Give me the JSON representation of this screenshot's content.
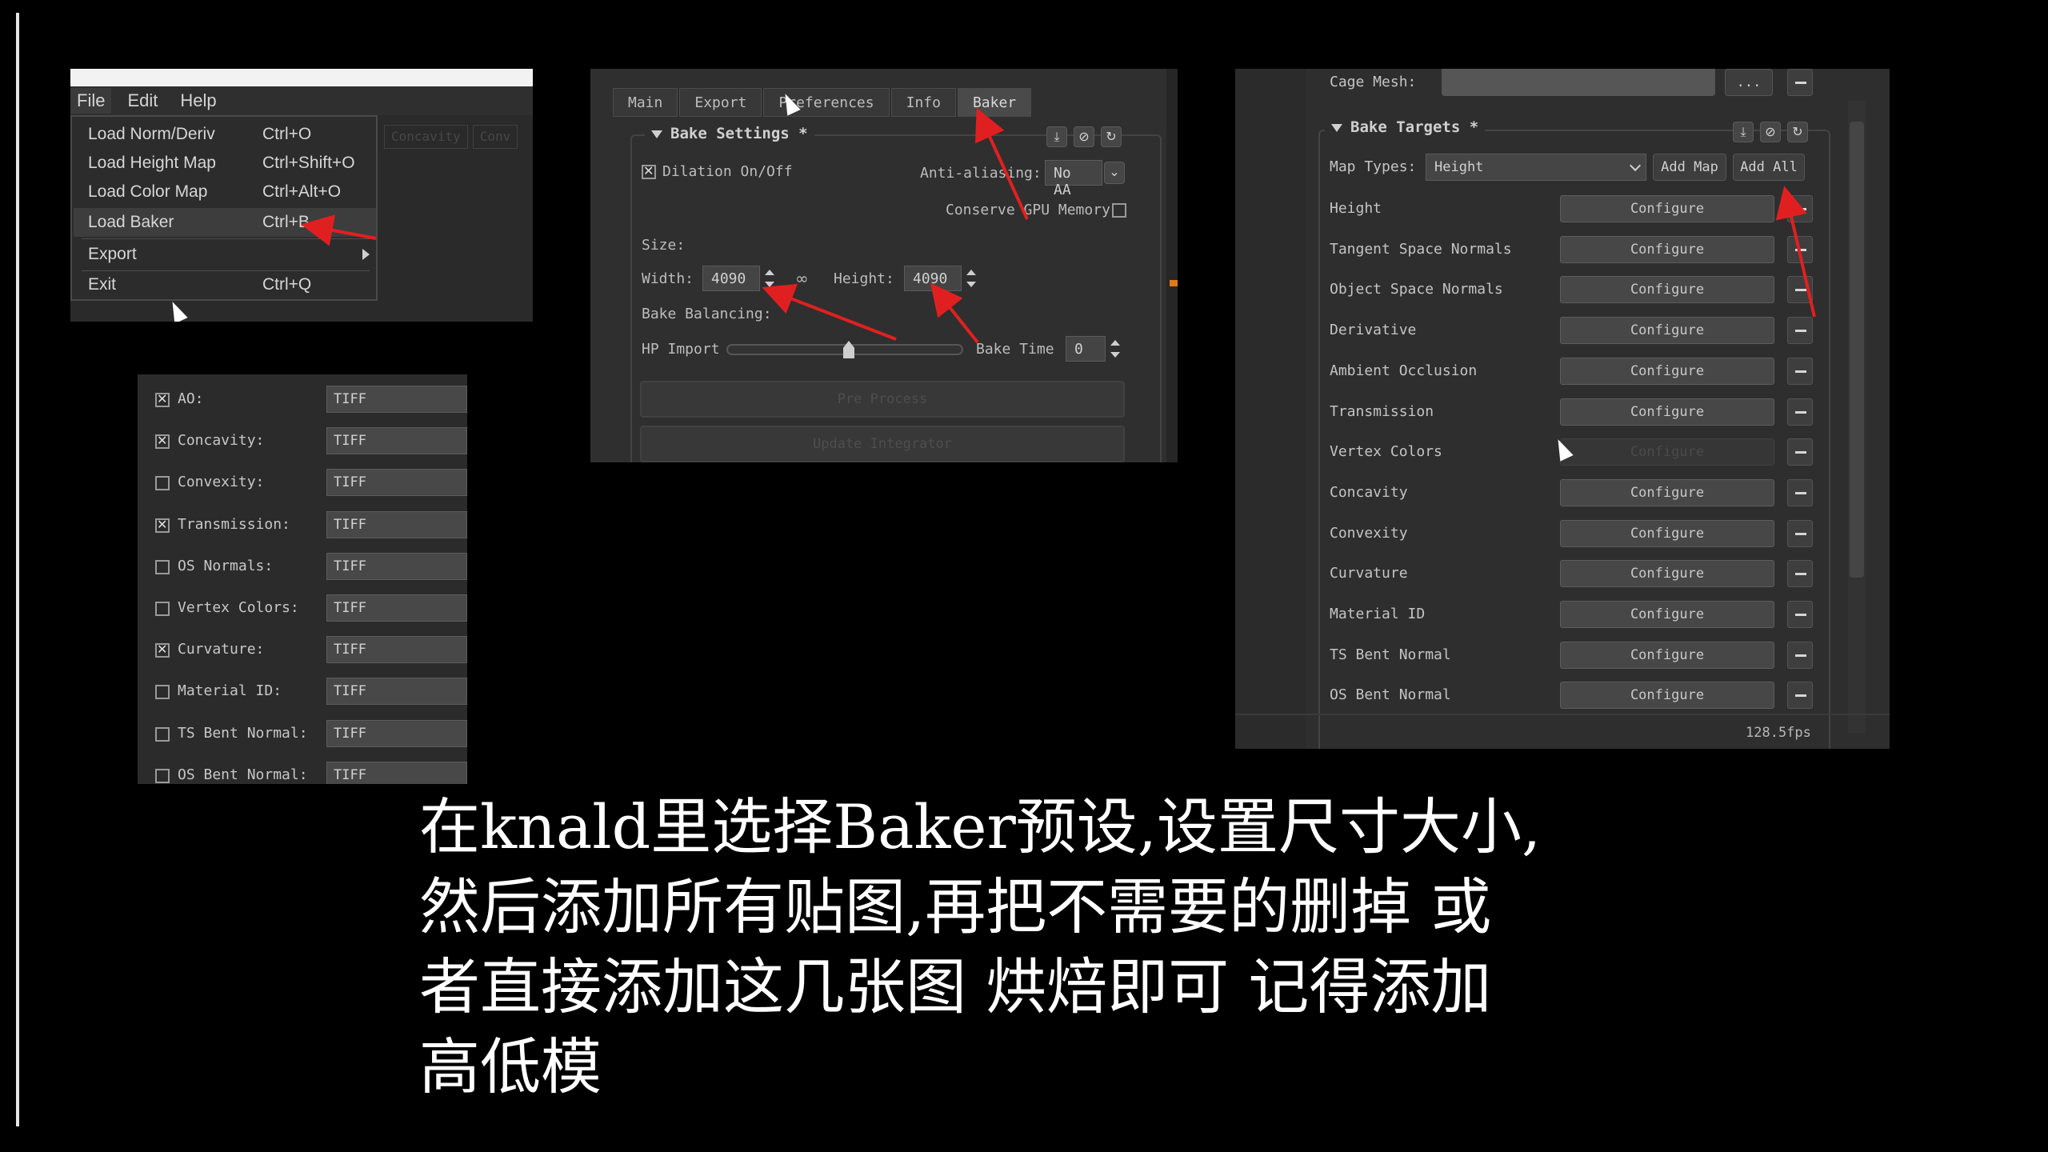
{
  "menu_panel": {
    "menubar": [
      "File",
      "Edit",
      "Help"
    ],
    "items": [
      {
        "label": "Load Norm/Deriv",
        "shortcut": "Ctrl+O"
      },
      {
        "label": "Load Height Map",
        "shortcut": "Ctrl+Shift+O"
      },
      {
        "label": "Load Color Map",
        "shortcut": "Ctrl+Alt+O"
      },
      {
        "label": "Load Baker",
        "shortcut": "Ctrl+B"
      },
      {
        "label": "Export",
        "shortcut": ""
      },
      {
        "label": "Exit",
        "shortcut": "Ctrl+Q"
      }
    ],
    "behind_tabs": [
      "Concavity",
      "Conv"
    ]
  },
  "baker_panel": {
    "tabs": [
      "Main",
      "Export",
      "Preferences",
      "Info",
      "Baker"
    ],
    "group_title": "Bake Settings *",
    "dilation_label": "Dilation On/Off",
    "anti_aliasing_label": "Anti-aliasing:",
    "anti_aliasing_value": "No AA",
    "conserve_gpu_label": "Conserve GPU Memory",
    "size_label": "Size:",
    "width_label": "Width:",
    "width_value": "4090",
    "height_label": "Height:",
    "height_value": "4090",
    "bake_balancing_label": "Bake Balancing:",
    "hp_import_label": "HP Import",
    "bake_time_label": "Bake Time",
    "bake_time_value": "0",
    "pre_process_label": "Pre Process",
    "update_integrator_label": "Update Integrator"
  },
  "targets_panel": {
    "cage_mesh_label": "Cage Mesh:",
    "cage_browse_label": "...",
    "group_title": "Bake Targets *",
    "map_types_label": "Map Types:",
    "map_types_value": "Height",
    "add_map_label": "Add Map",
    "add_all_label": "Add All",
    "configure_label": "Configure",
    "targets": [
      {
        "name": "Height",
        "enabled": true
      },
      {
        "name": "Tangent Space Normals",
        "enabled": true
      },
      {
        "name": "Object Space Normals",
        "enabled": true
      },
      {
        "name": "Derivative",
        "enabled": true
      },
      {
        "name": "Ambient Occlusion",
        "enabled": true
      },
      {
        "name": "Transmission",
        "enabled": true
      },
      {
        "name": "Vertex Colors",
        "enabled": false
      },
      {
        "name": "Concavity",
        "enabled": true
      },
      {
        "name": "Convexity",
        "enabled": true
      },
      {
        "name": "Curvature",
        "enabled": true
      },
      {
        "name": "Material ID",
        "enabled": true
      },
      {
        "name": "TS Bent Normal",
        "enabled": true
      },
      {
        "name": "OS Bent Normal",
        "enabled": true
      }
    ],
    "fps": "128.5fps"
  },
  "maps_panel": {
    "format": "TIFF",
    "rows": [
      {
        "name": "AO:",
        "checked": true
      },
      {
        "name": "Concavity:",
        "checked": true
      },
      {
        "name": "Convexity:",
        "checked": false
      },
      {
        "name": "Transmission:",
        "checked": true
      },
      {
        "name": "OS Normals:",
        "checked": false
      },
      {
        "name": "Vertex Colors:",
        "checked": false
      },
      {
        "name": "Curvature:",
        "checked": true
      },
      {
        "name": "Material ID:",
        "checked": false
      },
      {
        "name": "TS Bent Normal:",
        "checked": false
      },
      {
        "name": "OS Bent Normal:",
        "checked": false
      }
    ]
  },
  "caption": {
    "lines": [
      "在knald里选择Baker预设,设置尺寸大小,",
      "然后添加所有贴图,再把不需要的删掉 或",
      "者直接添加这几张图 烘焙即可 记得添加",
      "高低模"
    ]
  },
  "colors": {
    "arrow": "#e02020",
    "panel_bg": "#2e2e2e",
    "caption_text": "#ffffff"
  }
}
